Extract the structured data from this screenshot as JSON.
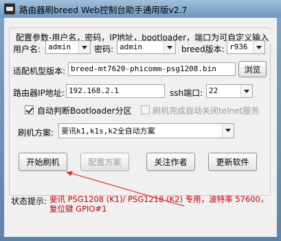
{
  "window": {
    "title": "路由器刷breed Web控制台助手通用版v2.7"
  },
  "group": {
    "title": "配置参数-用户名，密码，IP地址，bootloader，端口为可自定义输入"
  },
  "fields": {
    "username_label": "用户名:",
    "username_value": "admin",
    "password_label": "密码:",
    "password_value": "admin",
    "breed_label": "breed版本:",
    "breed_value": "r936",
    "firmware_label": "适配机型版本:",
    "firmware_value": "breed-mt7620-phicomm-psg1208.bin",
    "browse_label": "浏览",
    "ip_label": "路由器IP地址:",
    "ip_value": "192.168.2.1",
    "ssh_label": "ssh端口:",
    "ssh_value": "22"
  },
  "options": {
    "auto_detect_label": "自动判断Bootloader分区",
    "auto_detect_checked": true,
    "telnet_label": "刷机完成自动关闭telnet服务",
    "telnet_checked": false
  },
  "scheme": {
    "label": "刷机方案:",
    "value": "斐讯k1,k1s,k2全自动方案"
  },
  "buttons": {
    "start": "开始刷机",
    "config": "配置方案",
    "follow": "关注作者",
    "update": "更新软件"
  },
  "status": {
    "label": "状态提示:",
    "text": "斐讯 PSG1208 (K1)/ PSG1218 (K2) 专用，波特率 57600，复位键 GPIO#1"
  },
  "colors": {
    "status": "#c00000",
    "annotation_arrow": "#e03030"
  }
}
